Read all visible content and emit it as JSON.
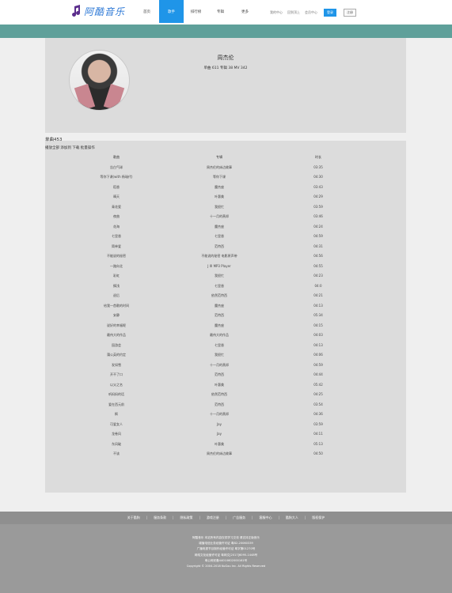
{
  "header": {
    "logo_text": "阿酷音乐",
    "nav": [
      {
        "label": "首页",
        "active": false
      },
      {
        "label": "歌手",
        "active": true
      },
      {
        "label": "排行榜",
        "active": false
      },
      {
        "label": "专辑",
        "active": false
      },
      {
        "label": "更多",
        "active": false
      }
    ],
    "user_links": [
      "我的中心",
      "回到顶上",
      "会员中心"
    ],
    "login_label": "登录",
    "register_label": "注册"
  },
  "profile": {
    "name": "周杰伦",
    "stats": "单曲 611 专辑 38 MV 342"
  },
  "songs": {
    "count_label": "单曲453",
    "actions": "播放全部 添加到 下载 批量操作",
    "columns": [
      "歌曲",
      "专辑",
      "时长"
    ],
    "rows": [
      {
        "title": "告白气球",
        "album": "周杰伦的床边故事",
        "duration": "03:35"
      },
      {
        "title": "等你下课(with 杨瑞代)",
        "album": "等你下课",
        "duration": "04:30"
      },
      {
        "title": "稻香",
        "album": "魔杰座",
        "duration": "03:43"
      },
      {
        "title": "晴天",
        "album": "叶惠美",
        "duration": "04:29"
      },
      {
        "title": "青花瓷",
        "album": "我很忙",
        "duration": "03:59"
      },
      {
        "title": "夜曲",
        "album": "十一月的萧邦",
        "duration": "03:46"
      },
      {
        "title": "花海",
        "album": "魔杰座",
        "duration": "04:24"
      },
      {
        "title": "七里香",
        "album": "七里香",
        "duration": "04:59"
      },
      {
        "title": "简单爱",
        "album": "范特西",
        "duration": "04:31"
      },
      {
        "title": "不能说的秘密",
        "album": "不能说的秘密 电影原声带",
        "duration": "04:56"
      },
      {
        "title": "一路向北",
        "album": "J III MP3 Player",
        "duration": "04:55"
      },
      {
        "title": "彩虹",
        "album": "我很忙",
        "duration": "04:23"
      },
      {
        "title": "搁浅",
        "album": "七里香",
        "duration": "04:0"
      },
      {
        "title": "退后",
        "album": "依然范特西",
        "duration": "04:21"
      },
      {
        "title": "给我一首歌的时间",
        "album": "魔杰座",
        "duration": "04:13"
      },
      {
        "title": "安静",
        "album": "范特西",
        "duration": "05:34"
      },
      {
        "title": "说好的幸福呢",
        "album": "魔杰座",
        "duration": "04:15"
      },
      {
        "title": "最伟大的作品",
        "album": "最伟大的作品",
        "duration": "04:03"
      },
      {
        "title": "园游会",
        "album": "七里香",
        "duration": "04:13"
      },
      {
        "title": "蒲公英的约定",
        "album": "我很忙",
        "duration": "04:06"
      },
      {
        "title": "发如雪",
        "album": "十一月的萧邦",
        "duration": "04:59"
      },
      {
        "title": "开不了口",
        "album": "范特西",
        "duration": "04:44"
      },
      {
        "title": "以父之名",
        "album": "叶惠美",
        "duration": "05:42"
      },
      {
        "title": "听妈妈的话",
        "album": "依然范特西",
        "duration": "04:25"
      },
      {
        "title": "爱在西元前",
        "album": "范特西",
        "duration": "03:54"
      },
      {
        "title": "枫",
        "album": "十一月的萧邦",
        "duration": "04:36"
      },
      {
        "title": "可爱女人",
        "album": "Jay",
        "duration": "03:59"
      },
      {
        "title": "龙卷风",
        "album": "Jay",
        "duration": "04:11"
      },
      {
        "title": "东风破",
        "album": "叶惠美",
        "duration": "05:13"
      },
      {
        "title": "不该",
        "album": "周杰伦的床边故事",
        "duration": "04:50"
      }
    ]
  },
  "footer": {
    "links": [
      "关于酷狗",
      "服务条款",
      "隐私政策",
      "游戏注册",
      "广告服务",
      "客服中心",
      "酷狗大人",
      "版权保护"
    ],
    "lines": [
      "阿酷音乐 本站所有内容仅供学习交流 请支持正版音乐",
      "增值电信业务经营许可证 粤B2-20060339",
      "广播电视节目制作经营许可证 粤字第01270号",
      "网络文化经营许可证 粤网文[2017]6095-1448号",
      "粤公网安备44010602000161号",
      "Copyright © 2004-2018 KuGou Inc. All Rights Reserved"
    ]
  },
  "colors": {
    "accent": "#1f95e8",
    "teal": "#5fa09a",
    "panel": "#dcdcdc",
    "footer": "#9a9a9a"
  }
}
